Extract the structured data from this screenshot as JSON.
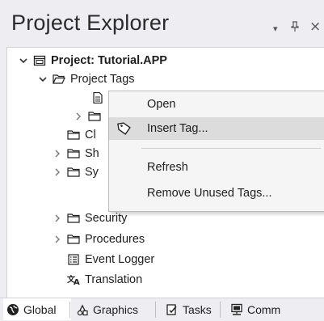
{
  "panel": {
    "title": "Project Explorer",
    "dropdown_icon": "▾",
    "pin_icon": "ꟸ",
    "close_icon": "×"
  },
  "tree": {
    "root": {
      "label": "Project: Tutorial.APP",
      "icon": "project-icon",
      "expanded": true
    },
    "items": [
      {
        "label": "Project Tags",
        "icon": "folder-open-icon",
        "expanded": true
      },
      {
        "label": "",
        "icon": "document-icon"
      },
      {
        "label": "",
        "icon": "folder-icon"
      },
      {
        "label": "Cl",
        "icon": "folder-icon"
      },
      {
        "label": "Sh",
        "icon": "folder-icon"
      },
      {
        "label": "Sy",
        "icon": "folder-icon"
      },
      {
        "label": "Security",
        "icon": "folder-icon"
      },
      {
        "label": "Procedures",
        "icon": "folder-icon"
      },
      {
        "label": "Event Logger",
        "icon": "event-logger-icon"
      },
      {
        "label": "Translation",
        "icon": "translation-icon"
      }
    ]
  },
  "context_menu": {
    "items": [
      {
        "label": "Open"
      },
      {
        "label": "Insert Tag...",
        "icon": "tag-icon",
        "highlighted": true
      },
      {
        "label": "Refresh"
      },
      {
        "label": "Remove Unused Tags..."
      }
    ]
  },
  "tabs": [
    {
      "label": "Global",
      "icon": "global-icon",
      "active": true
    },
    {
      "label": "Graphics",
      "icon": "graphics-icon"
    },
    {
      "label": "Tasks",
      "icon": "tasks-icon"
    },
    {
      "label": "Comm",
      "icon": "comm-icon"
    }
  ],
  "colors": {
    "panel_bg": "#eeeef2",
    "tree_bg": "#ffffff",
    "menu_highlight": "#dcdcdc"
  }
}
